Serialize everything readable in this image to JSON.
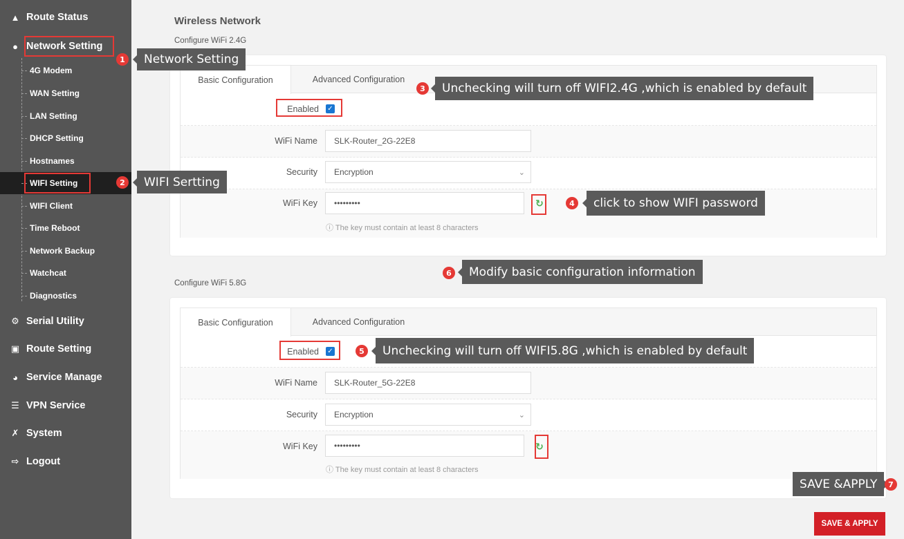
{
  "sidebar": {
    "route_status": "Route Status",
    "network_setting": "Network Setting",
    "sub_items": [
      "4G Modem",
      "WAN Setting",
      "LAN Setting",
      "DHCP Setting",
      "Hostnames",
      "WIFI Setting",
      "WIFI Client",
      "Time Reboot",
      "Network Backup",
      "Watchcat",
      "Diagnostics"
    ],
    "serial_utility": "Serial Utility",
    "route_setting": "Route Setting",
    "service_manage": "Service Manage",
    "vpn_service": "VPN Service",
    "system": "System",
    "logout": "Logout"
  },
  "main": {
    "title": "Wireless Network",
    "wifi24": {
      "section_label": "Configure WiFi 2.4G",
      "tab_basic": "Basic Configuration",
      "tab_advanced": "Advanced Configuration",
      "enabled_label": "Enabled",
      "name_label": "WiFi Name",
      "name_value": "SLK-Router_2G-22E8",
      "security_label": "Security",
      "security_value": "Encryption",
      "key_label": "WiFi Key",
      "key_value": "•••••••••",
      "hint": "ⓘ The key must contain at least 8 characters"
    },
    "wifi58": {
      "section_label": "Configure WiFi 5.8G",
      "tab_basic": "Basic Configuration",
      "tab_advanced": "Advanced Configuration",
      "enabled_label": "Enabled",
      "name_label": "WiFi Name",
      "name_value": "SLK-Router_5G-22E8",
      "security_label": "Security",
      "security_value": "Encryption",
      "key_label": "WiFi Key",
      "key_value": "•••••••••",
      "hint": "ⓘ The key must contain at least 8 characters"
    },
    "save_button": "SAVE & APPLY"
  },
  "annotations": {
    "a1": {
      "num": "1",
      "text": "Network Setting"
    },
    "a2": {
      "num": "2",
      "text": "WIFI Sertting"
    },
    "a3": {
      "num": "3",
      "text": "Unchecking will turn off WIFI2.4G ,which is enabled by default"
    },
    "a4": {
      "num": "4",
      "text": "click to show WIFI password"
    },
    "a5": {
      "num": "5",
      "text": "Unchecking will turn off WIFI5.8G ,which is enabled by default"
    },
    "a6": {
      "num": "6",
      "text": "Modify basic configuration information"
    },
    "a7": {
      "num": "7",
      "text": "SAVE &APPLY"
    }
  },
  "colors": {
    "sidebar_bg": "#555555",
    "active_bg": "#1f1f1f",
    "accent_red": "#d32027",
    "annotation_bg": "#5a5a5a",
    "checkbox_blue": "#1976d2"
  }
}
